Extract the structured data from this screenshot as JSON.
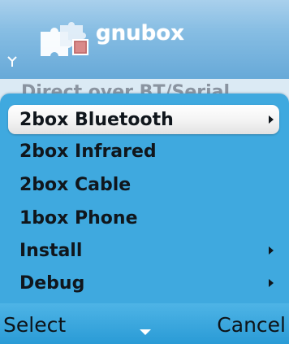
{
  "app": {
    "title": "gnubox",
    "icon": "puzzle-pieces-icon"
  },
  "status": {
    "signal_icon": "antenna-icon"
  },
  "background_view": {
    "text": "Direct over BT/Serial"
  },
  "menu": {
    "items": [
      {
        "label": "2box Bluetooth",
        "has_submenu": true,
        "selected": true
      },
      {
        "label": "2box Infrared",
        "has_submenu": false,
        "selected": false
      },
      {
        "label": "2box Cable",
        "has_submenu": false,
        "selected": false
      },
      {
        "label": "1box Phone",
        "has_submenu": false,
        "selected": false
      },
      {
        "label": "Install",
        "has_submenu": true,
        "selected": false
      },
      {
        "label": "Debug",
        "has_submenu": true,
        "selected": false
      }
    ]
  },
  "softkeys": {
    "left": "Select",
    "right": "Cancel",
    "center_icon": "down-arrow-icon"
  },
  "colors": {
    "menu_background": "#3fa9df",
    "highlight": "#ffffff",
    "title_bar": "#86bde3"
  }
}
